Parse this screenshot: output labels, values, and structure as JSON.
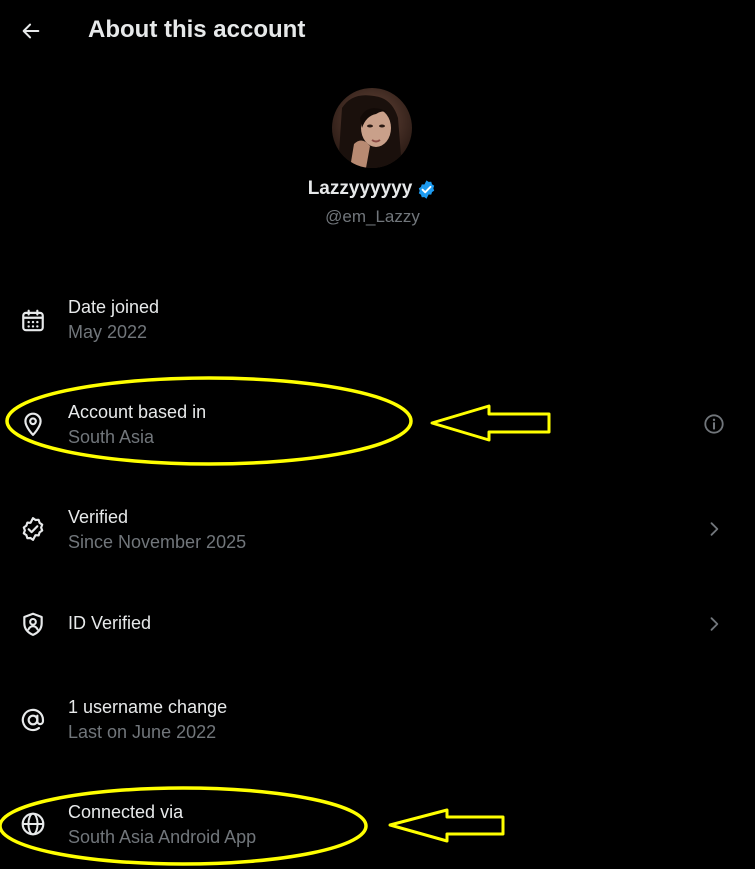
{
  "header": {
    "title": "About this account",
    "back_icon": "arrow-left-icon"
  },
  "profile": {
    "display_name": "Lazzyyyyyy",
    "handle": "@em_Lazzy",
    "verified_badge_color": "#1d9bf0"
  },
  "rows": [
    {
      "label": "Date joined",
      "value": "May 2022",
      "icon": "calendar-icon",
      "trailing": ""
    },
    {
      "label": "Account based in",
      "value": "South Asia",
      "icon": "location-pin-icon",
      "trailing": "info-icon"
    },
    {
      "label": "Verified",
      "value": "Since November 2025",
      "icon": "verified-check-icon",
      "trailing": "chevron-right-icon"
    },
    {
      "label": "ID Verified",
      "value": "",
      "icon": "shield-user-icon",
      "trailing": "chevron-right-icon"
    },
    {
      "label": "1 username change",
      "value": "Last on June 2022",
      "icon": "at-sign-icon",
      "trailing": ""
    },
    {
      "label": "Connected via",
      "value": "South Asia Android App",
      "icon": "globe-icon",
      "trailing": ""
    }
  ],
  "annotations": {
    "highlight_color": "#ffff00"
  },
  "colors": {
    "background": "#000000",
    "primary_text": "#e7e9ea",
    "secondary_text": "#71767b"
  }
}
